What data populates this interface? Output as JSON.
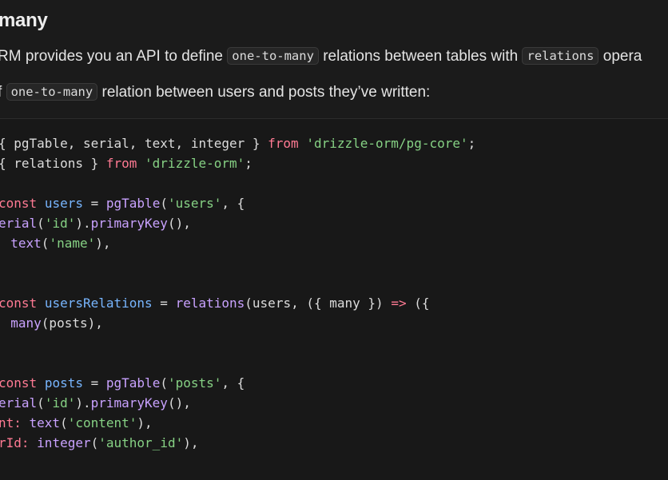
{
  "prose": {
    "heading": "many",
    "p1": {
      "a": "RM provides you an API to define ",
      "code1": "one-to-many",
      "b": " relations between tables with ",
      "code2": "relations",
      "c": " opera"
    },
    "p2": {
      "a": "f ",
      "code1": "one-to-many",
      "b": " relation between users and posts they’ve written:"
    }
  },
  "code": {
    "l1": {
      "a": "{ pgTable, serial, text, integer } ",
      "kw": "from",
      "sp": " ",
      "str": "'drizzle-orm/pg-core'",
      "end": ";"
    },
    "l2": {
      "a": "{ relations } ",
      "kw": "from",
      "sp": " ",
      "str": "'drizzle-orm'",
      "end": ";"
    },
    "l3": {
      "kw": "const",
      "sp1": " ",
      "var": "users",
      "eq": " = ",
      "fn": "pgTable",
      "open": "(",
      "str": "'users'",
      "end": ", {"
    },
    "l4": {
      "fn": "erial",
      "open": "(",
      "str": "'id'",
      "mid": ").",
      "fn2": "primaryKey",
      "end": "(),"
    },
    "l5": {
      "colon": ": ",
      "fn": "text",
      "open": "(",
      "str": "'name'",
      "end": "),"
    },
    "l6": {
      "kw": "const",
      "sp1": " ",
      "var": "usersRelations",
      "eq": " = ",
      "fn": "relations",
      "mid": "(users, ({ many }) ",
      "arrow": "=>",
      "end": " ({"
    },
    "l7": {
      "colon": ": ",
      "fn": "many",
      "end": "(posts),"
    },
    "l8": {
      "kw": "const",
      "sp1": " ",
      "var": "posts",
      "eq": " = ",
      "fn": "pgTable",
      "open": "(",
      "str": "'posts'",
      "end": ", {"
    },
    "l9": {
      "fn": "erial",
      "open": "(",
      "str": "'id'",
      "mid": ").",
      "fn2": "primaryKey",
      "end": "(),"
    },
    "l10": {
      "key": "nt",
      "colon": ": ",
      "fn": "text",
      "open": "(",
      "str": "'content'",
      "end": "),"
    },
    "l11": {
      "key": "rId",
      "colon": ": ",
      "fn": "integer",
      "open": "(",
      "str": "'author_id'",
      "end": "),"
    }
  }
}
